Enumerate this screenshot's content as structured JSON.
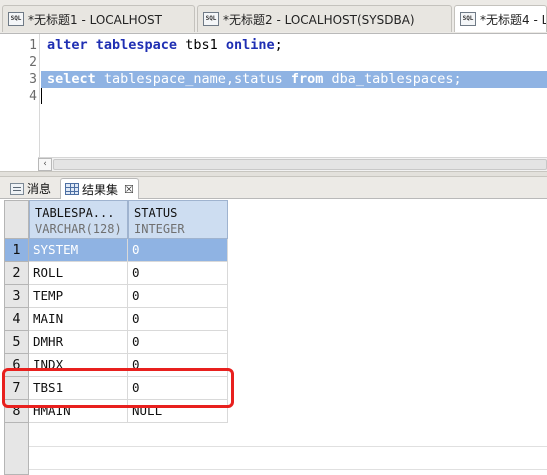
{
  "editor_tabs": [
    {
      "icon": "sql-file-icon",
      "label": "*无标题1 - LOCALHOST"
    },
    {
      "icon": "sql-file-icon",
      "label": "*无标题2 - LOCALHOST(SYSDBA)"
    },
    {
      "icon": "sql-file-icon",
      "label": "*无标题4 - L"
    }
  ],
  "editor": {
    "line_numbers": [
      "1",
      "2",
      "3",
      "4"
    ],
    "line1": {
      "kw1": "alter",
      "kw2": "tablespace",
      "id1": "tbs1",
      "kw3": "online",
      "punct": ";"
    },
    "line3": {
      "kw1": "select",
      "id1": "tablespace_name,status",
      "kw2": "from",
      "id2": "dba_tablespaces",
      "punct": ";"
    }
  },
  "result_tabs": [
    {
      "icon": "message-icon",
      "label": "消息"
    },
    {
      "icon": "grid-icon",
      "label": "结果集",
      "close": "☒"
    }
  ],
  "grid": {
    "columns": [
      {
        "name": "TABLESPA...",
        "type": "VARCHAR(128)"
      },
      {
        "name": "STATUS",
        "type": "INTEGER"
      }
    ],
    "rows": [
      {
        "num": "1",
        "name": "SYSTEM",
        "status": "0"
      },
      {
        "num": "2",
        "name": "ROLL",
        "status": "0"
      },
      {
        "num": "3",
        "name": "TEMP",
        "status": "0"
      },
      {
        "num": "4",
        "name": "MAIN",
        "status": "0"
      },
      {
        "num": "5",
        "name": "DMHR",
        "status": "0"
      },
      {
        "num": "6",
        "name": "INDX",
        "status": "0"
      },
      {
        "num": "7",
        "name": "TBS1",
        "status": "0"
      },
      {
        "num": "8",
        "name": "HMAIN",
        "status": "NULL"
      }
    ],
    "selected_row": "1",
    "highlighted_row": "7"
  },
  "colors": {
    "selection": "#8fb3e3",
    "keyword": "#1f2fb3",
    "annotation_box": "#e8201e"
  }
}
